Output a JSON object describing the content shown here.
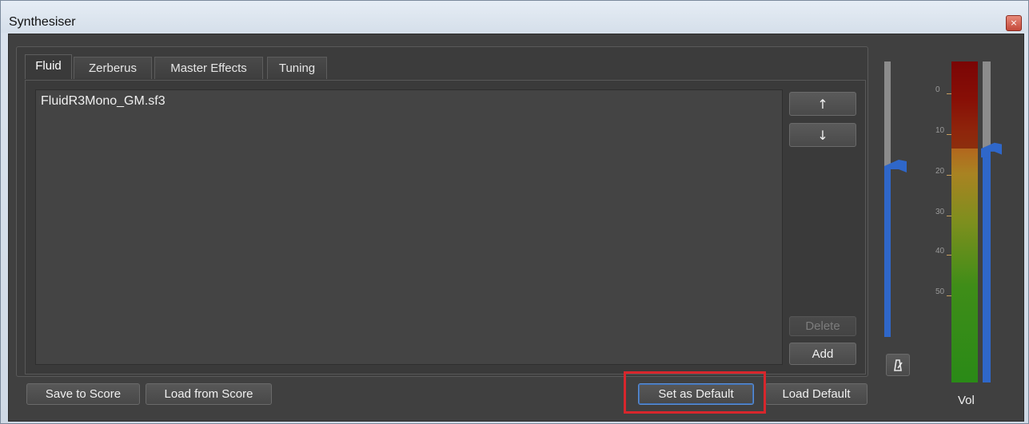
{
  "window": {
    "title": "Synthesiser",
    "close_symbol": "×"
  },
  "tabs": [
    {
      "label": "Fluid",
      "active": true
    },
    {
      "label": "Zerberus",
      "active": false
    },
    {
      "label": "Master Effects",
      "active": false
    },
    {
      "label": "Tuning",
      "active": false
    }
  ],
  "soundfonts": {
    "items": [
      "FluidR3Mono_GM.sf3"
    ]
  },
  "side_buttons": {
    "move_up": "↑",
    "move_down": "↓",
    "delete": "Delete",
    "add": "Add"
  },
  "bottom_buttons": {
    "save_to_score": "Save to Score",
    "load_from_score": "Load from Score",
    "set_as_default": "Set as Default",
    "load_default": "Load Default"
  },
  "master_gain": {
    "level": 0.62,
    "icon": "metronome-icon"
  },
  "volume_meter": {
    "label": "Vol",
    "ticks": [
      "0",
      "10",
      "20",
      "30",
      "40",
      "50"
    ],
    "level": 0.73
  },
  "colors": {
    "accent": "#2f67c9",
    "highlight": "#d8262c"
  }
}
